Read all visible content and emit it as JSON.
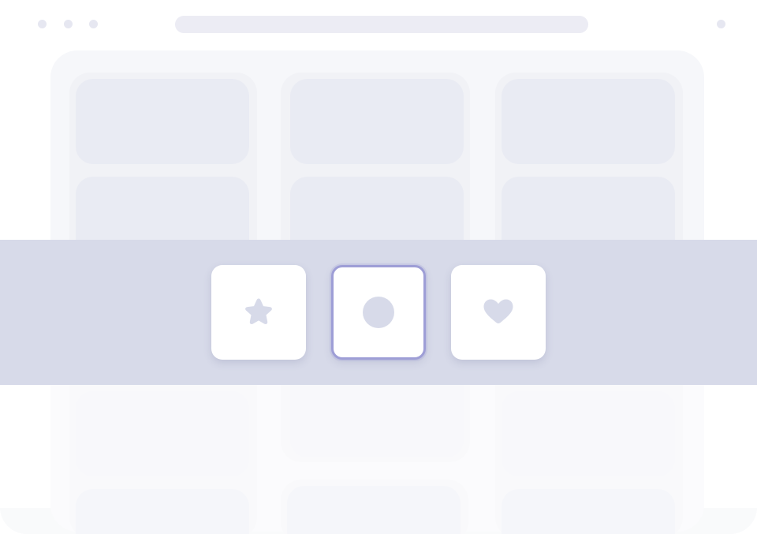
{
  "window": {
    "topbar": {
      "dots": [
        "dot",
        "dot",
        "dot"
      ],
      "right_dot": "dot"
    },
    "address_bar": {
      "value": ""
    }
  },
  "picker": {
    "selected_index": 1,
    "options": [
      {
        "icon": "star-icon",
        "selected": false
      },
      {
        "icon": "circle-icon",
        "selected": true
      },
      {
        "icon": "heart-icon",
        "selected": false
      }
    ]
  },
  "colors": {
    "accent": "#9e9ed6",
    "icon": "#d7dae9",
    "overlay": "#d7dae9",
    "skeleton": "#e9ebf3"
  }
}
